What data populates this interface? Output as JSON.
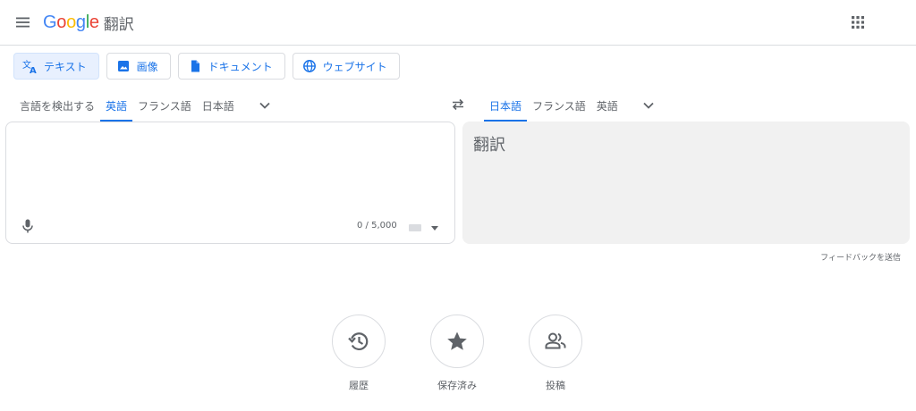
{
  "header": {
    "menu_icon": "hamburger-menu-icon",
    "logo_letters": [
      {
        "ch": "G",
        "color": "#4285F4"
      },
      {
        "ch": "o",
        "color": "#EA4335"
      },
      {
        "ch": "o",
        "color": "#FBBC05"
      },
      {
        "ch": "g",
        "color": "#4285F4"
      },
      {
        "ch": "l",
        "color": "#34A853"
      },
      {
        "ch": "e",
        "color": "#EA4335"
      }
    ],
    "logo_text": "Google",
    "product": "翻訳",
    "apps_icon": "apps-grid-icon"
  },
  "mode_tabs": [
    {
      "label": "テキスト",
      "icon": "translate-icon",
      "active": true
    },
    {
      "label": "画像",
      "icon": "image-icon",
      "active": false
    },
    {
      "label": "ドキュメント",
      "icon": "document-icon",
      "active": false
    },
    {
      "label": "ウェブサイト",
      "icon": "globe-icon",
      "active": false
    }
  ],
  "source_langs": {
    "items": [
      {
        "label": "言語を検出する",
        "active": false
      },
      {
        "label": "英語",
        "active": true
      },
      {
        "label": "フランス語",
        "active": false
      },
      {
        "label": "日本語",
        "active": false
      }
    ]
  },
  "target_langs": {
    "items": [
      {
        "label": "日本語",
        "active": true
      },
      {
        "label": "フランス語",
        "active": false
      },
      {
        "label": "英語",
        "active": false
      }
    ]
  },
  "source": {
    "value": "",
    "char_count": "0 / 5,000"
  },
  "target": {
    "text": "翻訳"
  },
  "feedback": "フィードバックを送信",
  "actions": [
    {
      "label": "履歴",
      "icon": "history-icon"
    },
    {
      "label": "保存済み",
      "icon": "star-icon"
    },
    {
      "label": "投稿",
      "icon": "people-icon"
    }
  ],
  "colors": {
    "accent": "#1a73e8",
    "active_tab_bg": "#e8f0fe",
    "border": "#dadce0",
    "text_secondary": "#5f6368",
    "output_bg": "#f1f1f1"
  }
}
